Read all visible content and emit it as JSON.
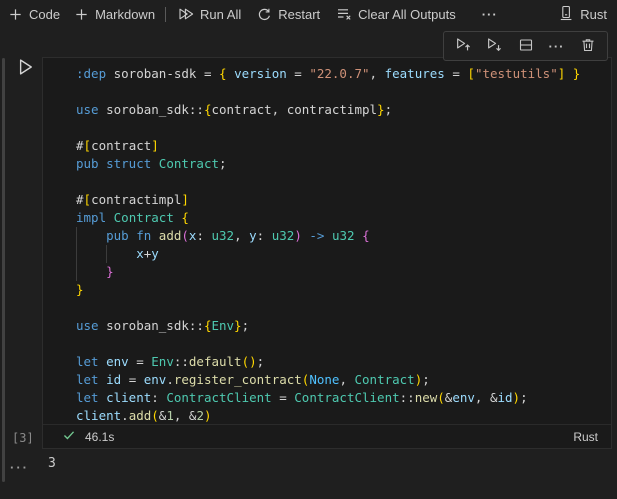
{
  "colors": {
    "kw": "#569CD6",
    "type": "#4EC9B0",
    "fn": "#DCDCAA",
    "var": "#9CDCFE",
    "str": "#CE9178",
    "num": "#B5CEA8",
    "txt": "#D4D4D4",
    "b1": "#FFD700",
    "b2": "#DA70D6",
    "enum": "#4FC1FF",
    "success_green": "#73C991",
    "editor_bg": "#1a1a1a",
    "page_bg": "#1f1f1f"
  },
  "toolbar": {
    "code": "Code",
    "markdown": "Markdown",
    "run_all": "Run All",
    "restart": "Restart",
    "clear_all_outputs": "Clear All Outputs",
    "more": "···",
    "kernel": "Rust"
  },
  "cell_toolbar": {
    "icons": [
      "execute-above",
      "execute-below",
      "split-cell",
      "more-actions",
      "delete-cell"
    ],
    "more": "···"
  },
  "cell": {
    "execution_count": "[3]",
    "status": {
      "success_time": "46.1s",
      "language": "Rust"
    },
    "output": {
      "more": "···",
      "value": "3"
    },
    "code": {
      "lines": [
        {
          "t": [
            [
              "kw",
              ":dep"
            ],
            [
              "txt",
              " soroban-sdk = "
            ],
            [
              "b1",
              "{"
            ],
            [
              "txt",
              " "
            ],
            [
              "var",
              "version"
            ],
            [
              "txt",
              " = "
            ],
            [
              "str",
              "\"22.0.7\""
            ],
            [
              "txt",
              ", "
            ],
            [
              "var",
              "features"
            ],
            [
              "txt",
              " = "
            ],
            [
              "b1",
              "["
            ],
            [
              "str",
              "\"testutils\""
            ],
            [
              "b1",
              "]"
            ],
            [
              "txt",
              " "
            ],
            [
              "b1",
              "}"
            ]
          ]
        },
        {
          "t": []
        },
        {
          "t": [
            [
              "kw",
              "use"
            ],
            [
              "txt",
              " soroban_sdk::"
            ],
            [
              "b1",
              "{"
            ],
            [
              "txt",
              "contract, contractimpl"
            ],
            [
              "b1",
              "}"
            ],
            [
              "txt",
              ";"
            ]
          ]
        },
        {
          "t": []
        },
        {
          "t": [
            [
              "txt",
              "#"
            ],
            [
              "b1",
              "["
            ],
            [
              "txt",
              "contract"
            ],
            [
              "b1",
              "]"
            ]
          ]
        },
        {
          "t": [
            [
              "kw",
              "pub struct"
            ],
            [
              "txt",
              " "
            ],
            [
              "type",
              "Contract"
            ],
            [
              "txt",
              ";"
            ]
          ]
        },
        {
          "t": []
        },
        {
          "t": [
            [
              "txt",
              "#"
            ],
            [
              "b1",
              "["
            ],
            [
              "txt",
              "contractimpl"
            ],
            [
              "b1",
              "]"
            ]
          ]
        },
        {
          "t": [
            [
              "kw",
              "impl"
            ],
            [
              "txt",
              " "
            ],
            [
              "type",
              "Contract"
            ],
            [
              "txt",
              " "
            ],
            [
              "b1",
              "{"
            ]
          ]
        },
        {
          "g": [
            0
          ],
          "t": [
            [
              "txt",
              "    "
            ],
            [
              "kw",
              "pub fn"
            ],
            [
              "txt",
              " "
            ],
            [
              "fn",
              "add"
            ],
            [
              "b2",
              "("
            ],
            [
              "var",
              "x"
            ],
            [
              "txt",
              ": "
            ],
            [
              "type",
              "u32"
            ],
            [
              "txt",
              ", "
            ],
            [
              "var",
              "y"
            ],
            [
              "txt",
              ": "
            ],
            [
              "type",
              "u32"
            ],
            [
              "b2",
              ")"
            ],
            [
              "kw",
              " -> "
            ],
            [
              "type",
              "u32"
            ],
            [
              "txt",
              " "
            ],
            [
              "b2",
              "{"
            ]
          ]
        },
        {
          "g": [
            0,
            4
          ],
          "t": [
            [
              "txt",
              "        "
            ],
            [
              "var",
              "x"
            ],
            [
              "txt",
              "+"
            ],
            [
              "var",
              "y"
            ]
          ]
        },
        {
          "g": [
            0
          ],
          "t": [
            [
              "txt",
              "    "
            ],
            [
              "b2",
              "}"
            ]
          ]
        },
        {
          "t": [
            [
              "b1",
              "}"
            ]
          ]
        },
        {
          "t": []
        },
        {
          "t": [
            [
              "kw",
              "use"
            ],
            [
              "txt",
              " soroban_sdk::"
            ],
            [
              "b1",
              "{"
            ],
            [
              "type",
              "Env"
            ],
            [
              "b1",
              "}"
            ],
            [
              "txt",
              ";"
            ]
          ]
        },
        {
          "t": []
        },
        {
          "t": [
            [
              "kw",
              "let"
            ],
            [
              "txt",
              " "
            ],
            [
              "var",
              "env"
            ],
            [
              "txt",
              " = "
            ],
            [
              "type",
              "Env"
            ],
            [
              "txt",
              "::"
            ],
            [
              "fn",
              "default"
            ],
            [
              "b1",
              "("
            ],
            [
              "b1",
              ")"
            ],
            [
              "txt",
              ";"
            ]
          ]
        },
        {
          "t": [
            [
              "kw",
              "let"
            ],
            [
              "txt",
              " "
            ],
            [
              "var",
              "id"
            ],
            [
              "txt",
              " = "
            ],
            [
              "var",
              "env"
            ],
            [
              "txt",
              "."
            ],
            [
              "fn",
              "register_contract"
            ],
            [
              "b1",
              "("
            ],
            [
              "enum",
              "None"
            ],
            [
              "txt",
              ", "
            ],
            [
              "type",
              "Contract"
            ],
            [
              "b1",
              ")"
            ],
            [
              "txt",
              ";"
            ]
          ]
        },
        {
          "t": [
            [
              "kw",
              "let"
            ],
            [
              "txt",
              " "
            ],
            [
              "var",
              "client"
            ],
            [
              "txt",
              ": "
            ],
            [
              "type",
              "ContractClient"
            ],
            [
              "txt",
              " = "
            ],
            [
              "type",
              "ContractClient"
            ],
            [
              "txt",
              "::"
            ],
            [
              "fn",
              "new"
            ],
            [
              "b1",
              "("
            ],
            [
              "txt",
              "&"
            ],
            [
              "var",
              "env"
            ],
            [
              "txt",
              ", &"
            ],
            [
              "var",
              "id"
            ],
            [
              "b1",
              ")"
            ],
            [
              "txt",
              ";"
            ]
          ]
        },
        {
          "t": [
            [
              "var",
              "client"
            ],
            [
              "txt",
              "."
            ],
            [
              "fn",
              "add"
            ],
            [
              "b1",
              "("
            ],
            [
              "txt",
              "&"
            ],
            [
              "num",
              "1"
            ],
            [
              "txt",
              ", &"
            ],
            [
              "num",
              "2"
            ],
            [
              "b1",
              ")"
            ]
          ]
        }
      ]
    }
  }
}
